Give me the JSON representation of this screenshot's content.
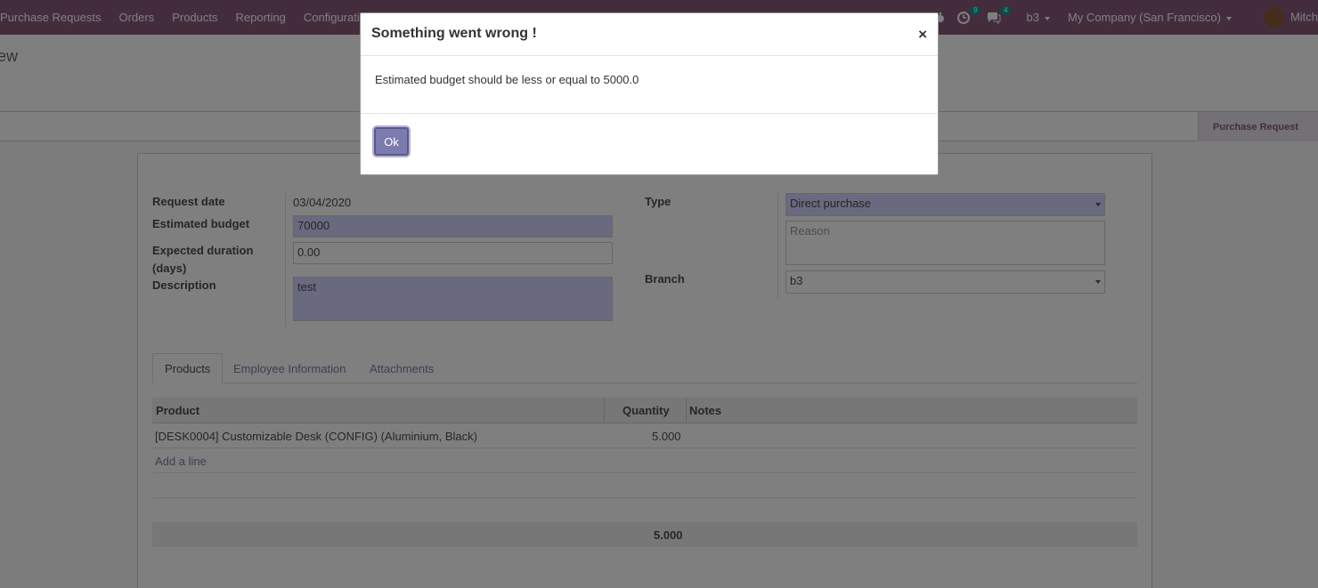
{
  "navbar": {
    "menu": [
      "Purchase Requests",
      "Orders",
      "Products",
      "Reporting",
      "Configuration"
    ],
    "activity_count": "9",
    "message_count": "4",
    "branch": "b3",
    "company": "My Company (San Francisco)",
    "user": "Mitch"
  },
  "control_panel": {
    "title": "ew",
    "status_stage": "Purchase Request"
  },
  "form": {
    "request_date_label": "Request date",
    "request_date": "03/04/2020",
    "estimated_budget_label": "Estimated budget",
    "estimated_budget": "70000",
    "expected_duration_label_1": "Expected duration",
    "expected_duration_label_2": "(days)",
    "expected_duration": "0.00",
    "description_label": "Description",
    "description": "test",
    "type_label": "Type",
    "type": "Direct purchase",
    "reason_placeholder": "Reason",
    "branch_label": "Branch",
    "branch": "b3"
  },
  "tabs": [
    "Products",
    "Employee Information",
    "Attachments"
  ],
  "table": {
    "headers": {
      "product": "Product",
      "quantity": "Quantity",
      "notes": "Notes"
    },
    "rows": [
      {
        "product": "[DESK0004] Customizable Desk (CONFIG) (Aluminium, Black)",
        "quantity": "5.000",
        "notes": ""
      }
    ],
    "add_line": "Add a line",
    "total_quantity": "5.000"
  },
  "dialog": {
    "title": "Something went wrong !",
    "close": "×",
    "message": "Estimated budget should be less or equal to 5000.0",
    "ok_label": "Ok"
  },
  "colors": {
    "navbar": "#875a7b",
    "primary_button": "#7c7bad",
    "required_field": "#d2d2ff"
  }
}
